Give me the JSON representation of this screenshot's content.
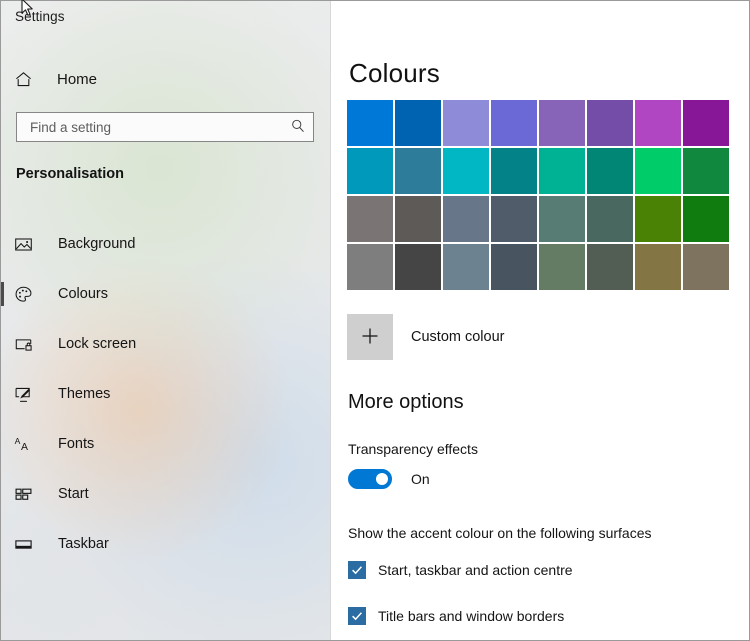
{
  "window": {
    "app_title": "Settings"
  },
  "sidebar": {
    "home_label": "Home",
    "home_icon": "home-icon",
    "search": {
      "placeholder": "Find a setting",
      "value": "",
      "icon": "search-icon"
    },
    "section_heading": "Personalisation",
    "items": [
      {
        "label": "Background",
        "icon": "image-icon",
        "selected": false
      },
      {
        "label": "Colours",
        "icon": "palette-icon",
        "selected": true
      },
      {
        "label": "Lock screen",
        "icon": "lock-screen-icon",
        "selected": false
      },
      {
        "label": "Themes",
        "icon": "brush-icon",
        "selected": false
      },
      {
        "label": "Fonts",
        "icon": "font-icon",
        "selected": false
      },
      {
        "label": "Start",
        "icon": "start-tiles-icon",
        "selected": false
      },
      {
        "label": "Taskbar",
        "icon": "taskbar-icon",
        "selected": false
      }
    ]
  },
  "main": {
    "page_title": "Colours",
    "swatches": [
      {
        "name": "blue",
        "hex": "#0078d7"
      },
      {
        "name": "navy-blue",
        "hex": "#0063b1"
      },
      {
        "name": "light-purple",
        "hex": "#8e8cd8"
      },
      {
        "name": "indigo",
        "hex": "#6b69d6"
      },
      {
        "name": "orchid",
        "hex": "#8764b8"
      },
      {
        "name": "purple",
        "hex": "#744da9"
      },
      {
        "name": "magenta",
        "hex": "#b146c2"
      },
      {
        "name": "dark-magenta",
        "hex": "#881798"
      },
      {
        "name": "teal-blue",
        "hex": "#0099bc"
      },
      {
        "name": "steel-teal",
        "hex": "#2d7d9a"
      },
      {
        "name": "cyan",
        "hex": "#00b7c3"
      },
      {
        "name": "dark-teal",
        "hex": "#038387"
      },
      {
        "name": "green-teal",
        "hex": "#00b294"
      },
      {
        "name": "deep-teal",
        "hex": "#018574"
      },
      {
        "name": "bright-green",
        "hex": "#00cc6a"
      },
      {
        "name": "green",
        "hex": "#10893e"
      },
      {
        "name": "warm-grey",
        "hex": "#7a7574"
      },
      {
        "name": "dark-warm-grey",
        "hex": "#5d5a58"
      },
      {
        "name": "blue-grey",
        "hex": "#68768a"
      },
      {
        "name": "slate-blue-grey",
        "hex": "#515c6b"
      },
      {
        "name": "sage-green",
        "hex": "#567c73"
      },
      {
        "name": "dark-sage",
        "hex": "#486860"
      },
      {
        "name": "olive-green",
        "hex": "#498205"
      },
      {
        "name": "forest-green",
        "hex": "#107c10"
      },
      {
        "name": "cool-grey",
        "hex": "#7e7e7e"
      },
      {
        "name": "charcoal",
        "hex": "#454545"
      },
      {
        "name": "blue-slate",
        "hex": "#6d8290"
      },
      {
        "name": "dark-slate",
        "hex": "#48545f"
      },
      {
        "name": "moss-green",
        "hex": "#647c64"
      },
      {
        "name": "dark-moss",
        "hex": "#525e54"
      },
      {
        "name": "dark-gold",
        "hex": "#847545"
      },
      {
        "name": "taupe",
        "hex": "#7e735f"
      }
    ],
    "custom_colour": {
      "label": "Custom colour",
      "icon": "plus-icon"
    },
    "more_options": {
      "title": "More options",
      "transparency": {
        "label": "Transparency effects",
        "state_label": "On",
        "checked": true
      },
      "surfaces": {
        "label": "Show the accent colour on the following surfaces",
        "options": [
          {
            "label": "Start, taskbar and action centre",
            "checked": true
          },
          {
            "label": "Title bars and window borders",
            "checked": true
          }
        ]
      }
    }
  },
  "theme": {
    "accent": "#0078d4",
    "checkbox_fill": "#2b6ca3",
    "sidebar_bg": "#e9eaea",
    "content_bg": "#ffffff"
  }
}
